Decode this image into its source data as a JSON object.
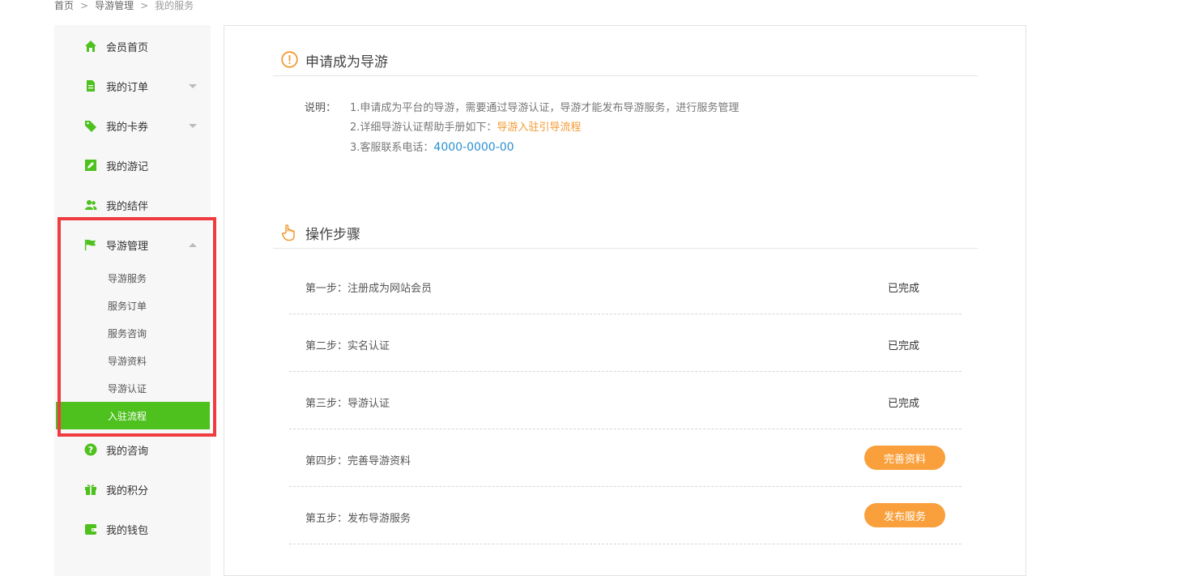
{
  "breadcrumb": {
    "home": "首页",
    "section": "导游管理",
    "current": "我的服务",
    "separator": ">"
  },
  "sidebar": {
    "items": [
      {
        "label": "会员首页",
        "icon": "home-icon"
      },
      {
        "label": "我的订单",
        "icon": "document-icon"
      },
      {
        "label": "我的卡券",
        "icon": "tag-icon"
      },
      {
        "label": "我的游记",
        "icon": "edit-icon"
      },
      {
        "label": "我的结伴",
        "icon": "users-icon"
      },
      {
        "label": "导游管理",
        "icon": "flag-icon"
      },
      {
        "label": "我的咨询",
        "icon": "question-icon"
      },
      {
        "label": "我的积分",
        "icon": "gift-icon"
      },
      {
        "label": "我的钱包",
        "icon": "wallet-icon"
      }
    ],
    "sub_items": [
      {
        "label": "导游服务"
      },
      {
        "label": "服务订单"
      },
      {
        "label": "服务咨询"
      },
      {
        "label": "导游资料"
      },
      {
        "label": "导游认证"
      },
      {
        "label": "入驻流程"
      }
    ],
    "active_sub": "入驻流程"
  },
  "apply": {
    "title": "申请成为导游",
    "desc_label": "说明：",
    "line1": "1.申请成为平台的导游，需要通过导游认证，导游才能发布导游服务，进行服务管理",
    "line2_prefix": "2.详细导游认证帮助手册如下：",
    "line2_link": "导游入驻引导流程",
    "line3_prefix": "3.客服联系电话：",
    "phone": "4000-0000-00"
  },
  "steps": {
    "title": "操作步骤",
    "items": [
      {
        "text": "第一步：注册成为网站会员",
        "status": "已完成"
      },
      {
        "text": "第二步：实名认证",
        "status": "已完成"
      },
      {
        "text": "第三步：导游认证",
        "status": "已完成"
      },
      {
        "text": "第四步：完善导游资料",
        "action": "完善资料"
      },
      {
        "text": "第五步：发布导游服务",
        "action": "发布服务"
      }
    ]
  },
  "colors": {
    "accent_green": "#4ec11e",
    "accent_orange": "#f9a03c",
    "highlight_red": "#ef3c40",
    "link_blue": "#2a8fd2"
  }
}
